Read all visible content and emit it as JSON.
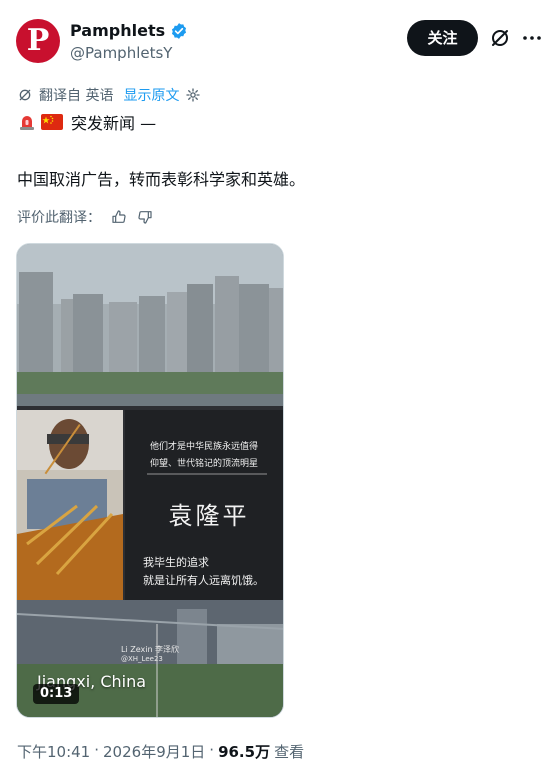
{
  "author": {
    "display_name": "Pamphlets",
    "handle": "@PamphletsY",
    "avatar_letter": "P",
    "avatar_color": "#c8102e",
    "verified": true
  },
  "actions": {
    "follow_label": "关注"
  },
  "translation": {
    "label": "翻译自 英语",
    "show_original": "显示原文"
  },
  "post": {
    "breaking": "突发新闻 —",
    "text": "中国取消广告，转而表彰科学家和英雄。",
    "rate_label": "评价此翻译："
  },
  "media": {
    "billboard_line1": "他们才是中华民族永远值得",
    "billboard_line2": "仰望、世代铭记的顶流明星",
    "billboard_name": "袁隆平",
    "billboard_quote1": "我毕生的追求",
    "billboard_quote2": "就是让所有人远离饥饿。",
    "credit_line1": "Li Zexin 李泽欣",
    "credit_line2": "@XH_Lee23",
    "location": "Jiangxi, China",
    "duration": "0:13"
  },
  "meta": {
    "time": "下午10:41",
    "separator": "·",
    "date": "2026年9月1日",
    "views": "96.5万",
    "views_label": "查看"
  },
  "colors": {
    "accent": "#1d9bf0",
    "text": "#0f1419",
    "secondary": "#536471"
  }
}
